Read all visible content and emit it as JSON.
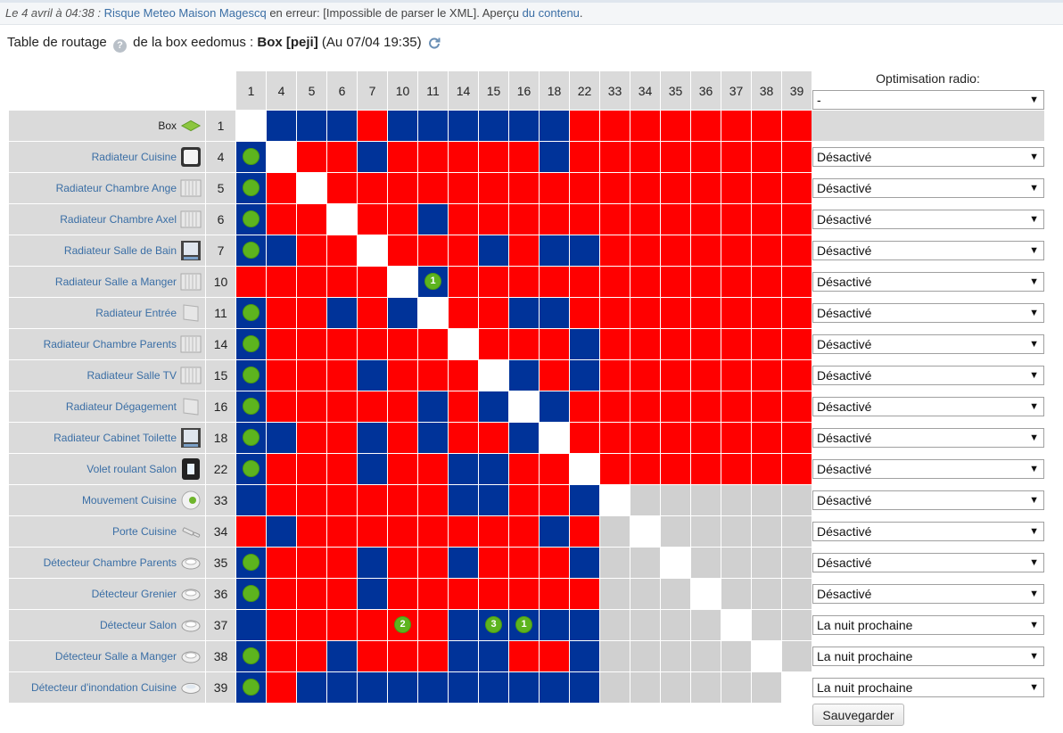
{
  "topbar": {
    "date": "Le 4 avril à 04:38 :",
    "alert_link": "Risque Meteo Maison Magescq",
    "message": "en erreur: [Impossible de parser le XML]. Aperçu",
    "content_link": "du contenu",
    "end": "."
  },
  "header": {
    "prefix": "Table de routage",
    "help_icon": "?",
    "middle": "de la box eedomus :",
    "box_name": "Box [peji]",
    "updated": "(Au 07/04 19:35)"
  },
  "columns": [
    "1",
    "4",
    "5",
    "6",
    "7",
    "10",
    "11",
    "14",
    "15",
    "16",
    "18",
    "22",
    "33",
    "34",
    "35",
    "36",
    "37",
    "38",
    "39"
  ],
  "rows": [
    {
      "label": "Box",
      "id": "1",
      "icon": "box-icon",
      "option": null
    },
    {
      "label": "Radiateur Cuisine",
      "id": "4",
      "icon": "radiator-white-icon",
      "option": "Désactivé"
    },
    {
      "label": "Radiateur Chambre Ange",
      "id": "5",
      "icon": "radiator-icon",
      "option": "Désactivé"
    },
    {
      "label": "Radiateur Chambre Axel",
      "id": "6",
      "icon": "radiator-icon",
      "option": "Désactivé"
    },
    {
      "label": "Radiateur Salle de Bain",
      "id": "7",
      "icon": "radiator-dark-icon",
      "option": "Désactivé"
    },
    {
      "label": "Radiateur Salle a Manger",
      "id": "10",
      "icon": "radiator-icon",
      "option": "Désactivé"
    },
    {
      "label": "Radiateur Entrée",
      "id": "11",
      "icon": "panel-icon",
      "option": "Désactivé"
    },
    {
      "label": "Radiateur Chambre Parents",
      "id": "14",
      "icon": "radiator-icon",
      "option": "Désactivé"
    },
    {
      "label": "Radiateur Salle TV",
      "id": "15",
      "icon": "radiator-icon",
      "option": "Désactivé"
    },
    {
      "label": "Radiateur Dégagement",
      "id": "16",
      "icon": "panel-icon",
      "option": "Désactivé"
    },
    {
      "label": "Radiateur Cabinet Toilette",
      "id": "18",
      "icon": "radiator-dark-icon",
      "option": "Désactivé"
    },
    {
      "label": "Volet roulant Salon",
      "id": "22",
      "icon": "shutter-switch-icon",
      "option": "Désactivé"
    },
    {
      "label": "Mouvement Cuisine",
      "id": "33",
      "icon": "motion-sensor-icon",
      "option": "Désactivé"
    },
    {
      "label": "Porte Cuisine",
      "id": "34",
      "icon": "door-sensor-icon",
      "option": "Désactivé"
    },
    {
      "label": "Détecteur Chambre Parents",
      "id": "35",
      "icon": "smoke-detector-icon",
      "option": "Désactivé"
    },
    {
      "label": "Détecteur Grenier",
      "id": "36",
      "icon": "smoke-detector-icon",
      "option": "Désactivé"
    },
    {
      "label": "Détecteur Salon",
      "id": "37",
      "icon": "smoke-detector-icon",
      "option": "La nuit prochaine"
    },
    {
      "label": "Détecteur Salle a Manger",
      "id": "38",
      "icon": "smoke-detector-icon",
      "option": "La nuit prochaine"
    },
    {
      "label": "Détecteur d'inondation Cuisine",
      "id": "39",
      "icon": "flood-detector-icon",
      "option": "La nuit prochaine"
    }
  ],
  "matrix": [
    "WBBBRBBBBBBRRRRRRRR",
    "GWRRBRRRRRBRRRRRRRR",
    "GRWRRRRRRRRRRRRRRRR",
    "GRRWRRBRRRRRRRRRRRR",
    "GBRRWRRRBRBBRRRRRRR",
    "RRRRRWBRRRRRRRRRRRR",
    "GRRBRBWRRBBRRRRRRRR",
    "GRRRRRRWRRRBRRRRRRR",
    "GRRRBRRRWBRBRRRRRRR",
    "GRRRRRBRBWBRRRRRRRR",
    "GBRRBRBRRBWRRRRRRRR",
    "GRRRBRRBBRRWRRRRRRR",
    "BRRRRRRBBRRBWSSSSSS",
    "RBRRRRRRRRBRSWSSSSS",
    "GRRRBRRBRRRBSSWSSSS",
    "GRRRBRRRRRRRSSSWSSS",
    "BRRRRRRBBBBBSSSSWSS",
    "GRRBRRRBBRRBSSSSSWS",
    "GRBBBBBBBBBBSSSSSSW"
  ],
  "hop_dots": [
    {
      "row": 5,
      "col": 6,
      "n": "1"
    },
    {
      "row": 16,
      "col": 5,
      "n": "2"
    },
    {
      "row": 16,
      "col": 8,
      "n": "3"
    },
    {
      "row": 16,
      "col": 9,
      "n": "1"
    }
  ],
  "optimisation": {
    "title": "Optimisation radio:",
    "header_value": "-"
  },
  "save_label": "Sauvegarder",
  "colors": {
    "red": "#ff0000",
    "blue": "#003399",
    "green_dot": "#5db41e",
    "grey": "#d0d0d0",
    "header_bg": "#dadada",
    "link": "#3a6ea5"
  }
}
